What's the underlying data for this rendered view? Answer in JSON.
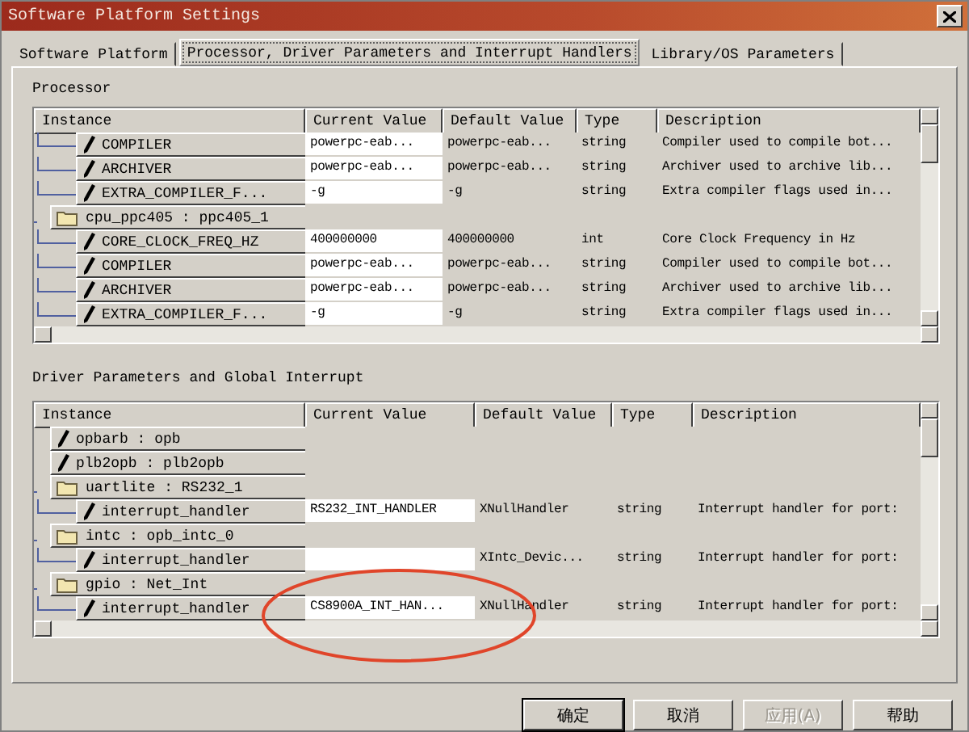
{
  "window": {
    "title": "Software Platform Settings"
  },
  "tabs": [
    {
      "label": "Software Platform",
      "selected": false
    },
    {
      "label": "Processor, Driver Parameters and Interrupt Handlers",
      "selected": true
    },
    {
      "label": "Library/OS Parameters",
      "selected": false
    }
  ],
  "processor": {
    "heading": "Processor",
    "columns": [
      "Instance",
      "Current Value",
      "Default Value",
      "Type",
      "Description"
    ],
    "rows": [
      {
        "kind": "continued",
        "children": [
          {
            "kind": "parameter",
            "label": "COMPILER",
            "current": "powerpc-eab...",
            "default": "powerpc-eab...",
            "type": "string",
            "description": "Compiler used to compile bot..."
          },
          {
            "kind": "parameter",
            "label": "ARCHIVER",
            "current": "powerpc-eab...",
            "default": "powerpc-eab...",
            "type": "string",
            "description": "Archiver used to archive lib..."
          },
          {
            "kind": "parameter",
            "label": "EXTRA_COMPILER_F...",
            "current": "-g",
            "default": "-g",
            "type": "string",
            "description": "Extra compiler flags used in..."
          }
        ]
      },
      {
        "kind": "instance",
        "label": "cpu_ppc405 : ppc405_1",
        "children": [
          {
            "kind": "parameter",
            "label": "CORE_CLOCK_FREQ_HZ",
            "current": "400000000",
            "default": "400000000",
            "type": "int",
            "description": "Core Clock Frequency in Hz"
          },
          {
            "kind": "parameter",
            "label": "COMPILER",
            "current": "powerpc-eab...",
            "default": "powerpc-eab...",
            "type": "string",
            "description": "Compiler used to compile bot..."
          },
          {
            "kind": "parameter",
            "label": "ARCHIVER",
            "current": "powerpc-eab...",
            "default": "powerpc-eab...",
            "type": "string",
            "description": "Archiver used to archive lib..."
          },
          {
            "kind": "parameter",
            "label": "EXTRA_COMPILER_F...",
            "current": "-g",
            "default": "-g",
            "type": "string",
            "description": "Extra compiler flags used in..."
          }
        ]
      }
    ]
  },
  "drivers": {
    "heading": "Driver Parameters and Global Interrupt",
    "columns": [
      "Instance",
      "Current Value",
      "Default Value",
      "Type",
      "Description"
    ],
    "rows": [
      {
        "kind": "component",
        "label": "opbarb : opb"
      },
      {
        "kind": "component",
        "label": "plb2opb : plb2opb"
      },
      {
        "kind": "instance",
        "label": "uartlite : RS232_1",
        "children": [
          {
            "kind": "parameter",
            "label": "interrupt_handler",
            "current": "RS232_INT_HANDLER",
            "default": "XNullHandler",
            "type": "string",
            "description": "Interrupt handler for port:"
          }
        ]
      },
      {
        "kind": "instance",
        "label": "intc : opb_intc_0",
        "children": [
          {
            "kind": "parameter",
            "label": "interrupt_handler",
            "default": "XIntc_Devic...",
            "type": "string",
            "description": "Interrupt handler for port:"
          }
        ]
      },
      {
        "kind": "instance",
        "label": "gpio : Net_Int",
        "children": [
          {
            "kind": "parameter",
            "label": "interrupt_handler",
            "current": "CS8900A_INT_HAN...",
            "default": "XNullHandler",
            "type": "string",
            "description": "Interrupt handler for port:"
          }
        ]
      }
    ]
  },
  "annotation": {
    "kind": "ellipse",
    "color": "#e0452a"
  },
  "buttons": [
    {
      "label": "确定",
      "disabled": false,
      "default": true
    },
    {
      "label": "取消",
      "disabled": false,
      "default": false
    },
    {
      "label": "应用(A)",
      "disabled": true,
      "default": false
    },
    {
      "label": "帮助",
      "disabled": false,
      "default": false
    }
  ]
}
